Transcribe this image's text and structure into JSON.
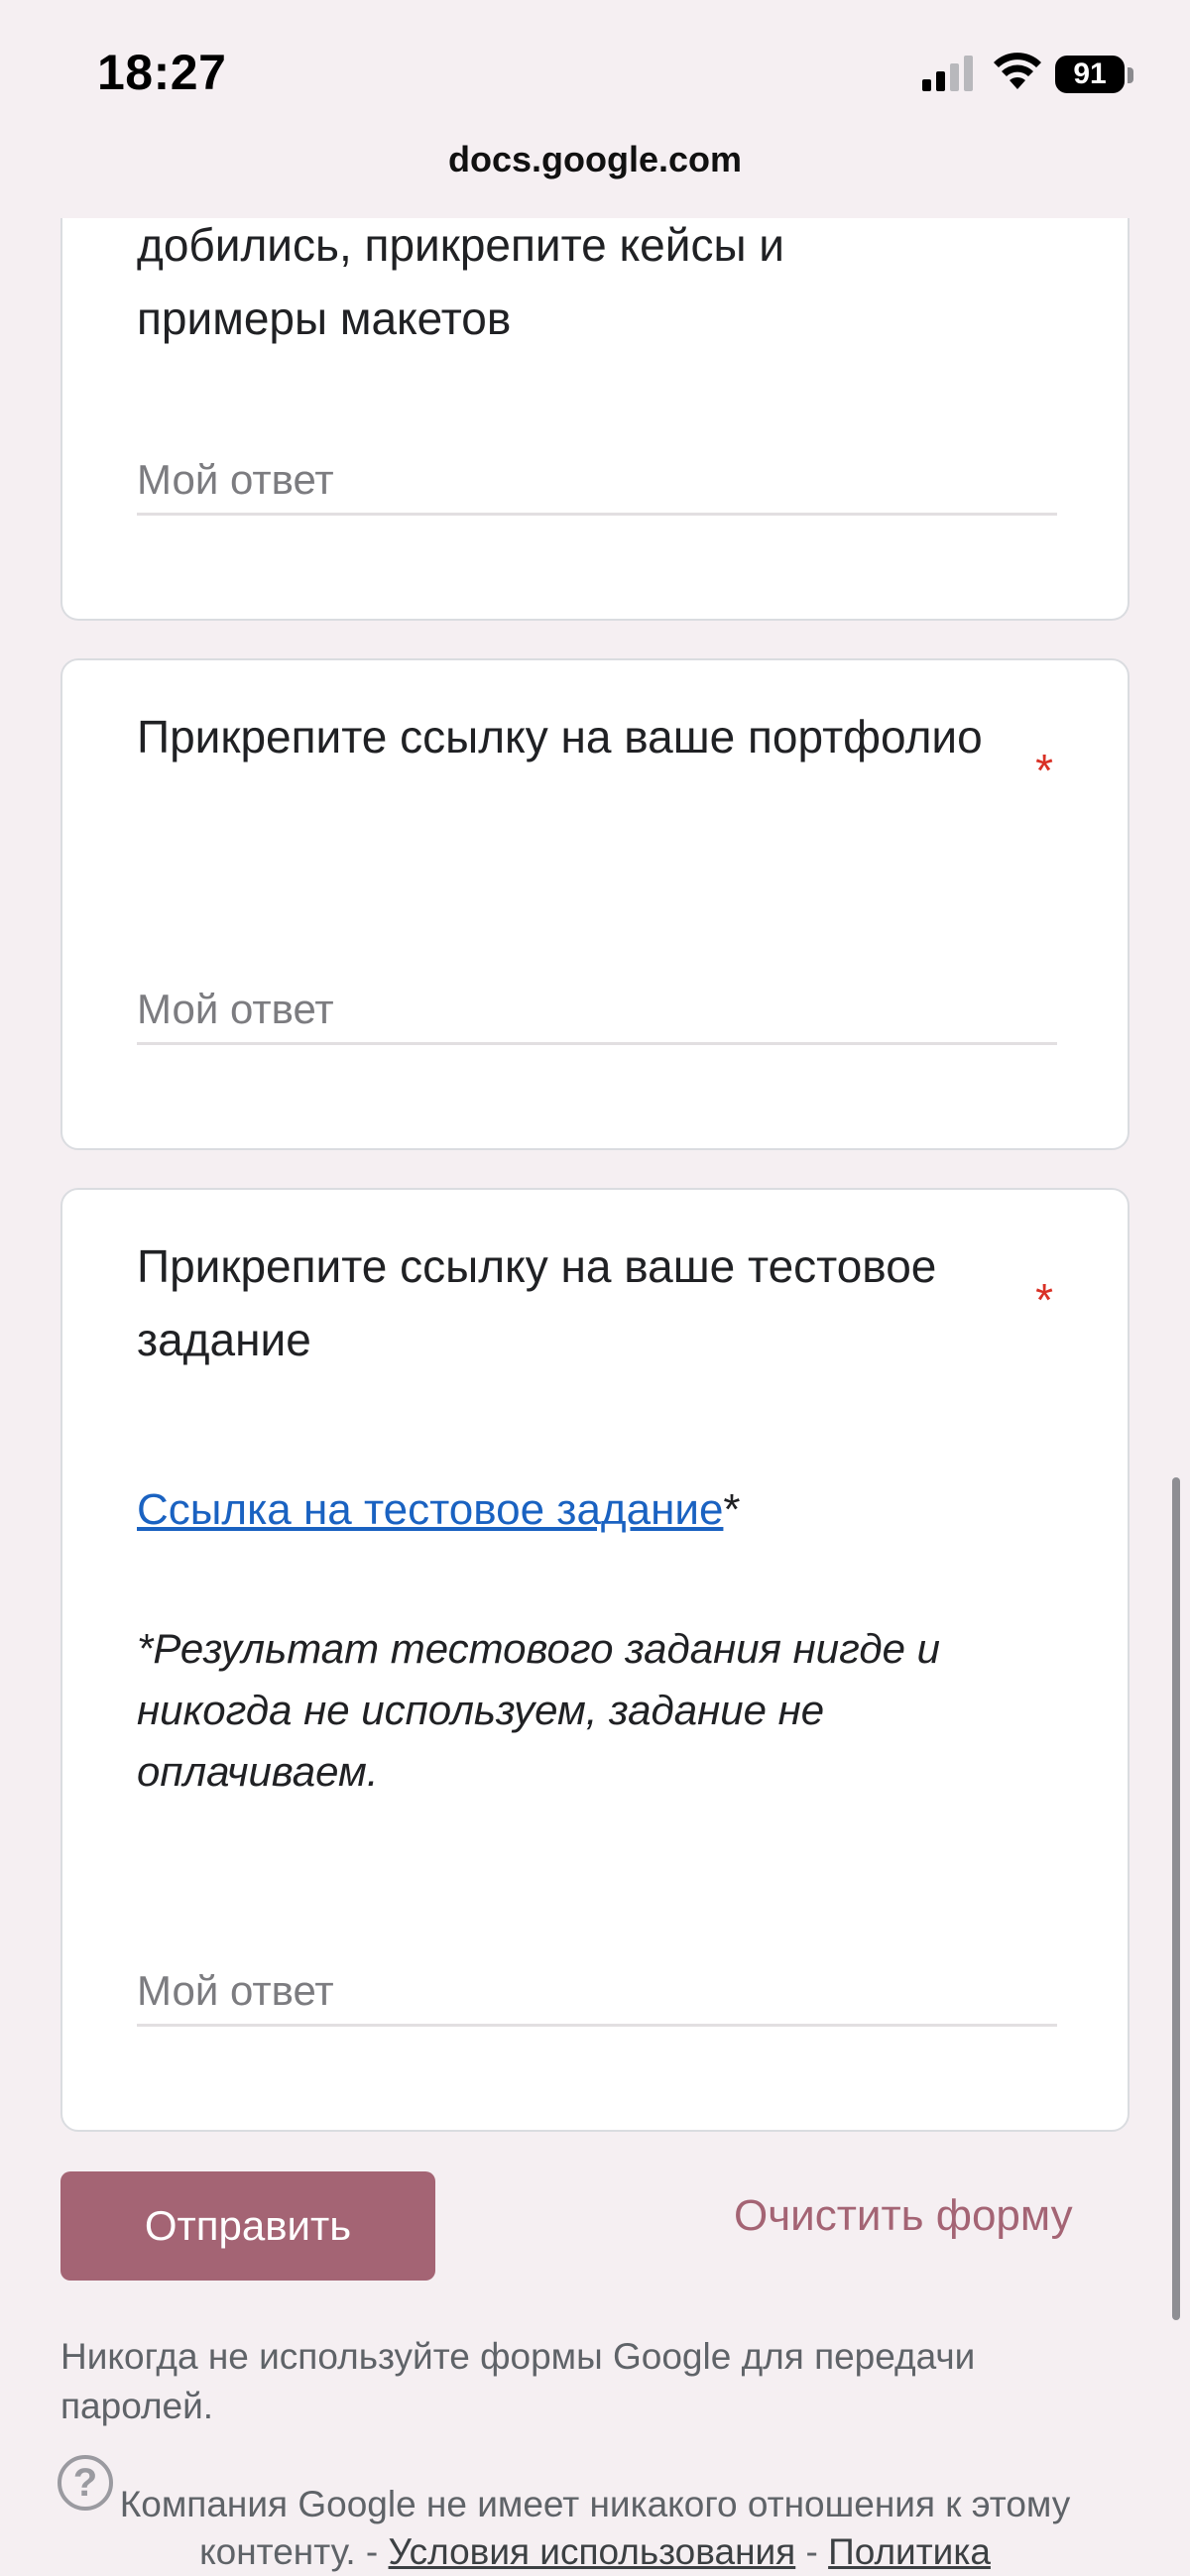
{
  "status_bar": {
    "time": "18:27",
    "battery": "91",
    "url": "docs.google.com"
  },
  "partial_question": {
    "title_line_1": "добились, прикрепите кейсы и",
    "title_line_2": "примеры макетов",
    "answer_placeholder": "Мой ответ"
  },
  "portfolio_question": {
    "title": "Прикрепите ссылку на ваше портфолио",
    "required_mark": "*",
    "answer_placeholder": "Мой ответ"
  },
  "test_question": {
    "title": "Прикрепите ссылку на ваше тестовое задание",
    "required_mark": "*",
    "link_text": "Ссылка на тестовое задание",
    "link_suffix": "*",
    "note": "*Результат тестового задания нигде и никогда не используем, задание не оплачиваем.",
    "answer_placeholder": "Мой ответ"
  },
  "actions": {
    "submit_label": "Отправить",
    "clear_label": "Очистить форму"
  },
  "footer": {
    "password_warning": "Никогда не используйте формы Google для передачи паролей.",
    "company_text": "Компания Google не имеет никакого отношения к этому контенту. -",
    "terms_link": "Условия использования",
    "separator": "-",
    "policy_link": "Политика",
    "help_icon": "?"
  },
  "colors": {
    "accent": "#a46474",
    "link": "#1a62c1",
    "required": "#d93025",
    "background": "#f5eff2"
  }
}
